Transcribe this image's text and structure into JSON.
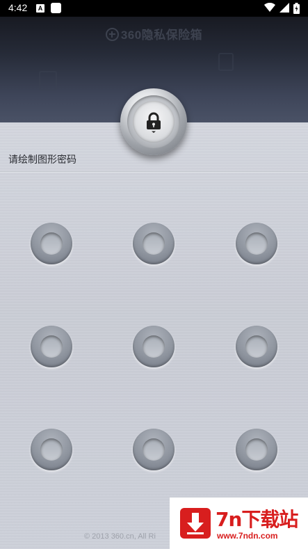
{
  "status_bar": {
    "time": "4:42",
    "a_icon_label": "A"
  },
  "header": {
    "logo_text": "360隐私保险箱"
  },
  "main": {
    "prompt": "请绘制图形密码",
    "pattern_dots_count": 9,
    "footer": "© 2013 360.cn, All Ri"
  },
  "watermark": {
    "title": "7n下载站",
    "url": "www.7ndn.com"
  },
  "icons": {
    "lock": "lock-icon",
    "wifi": "wifi-icon",
    "signal": "signal-icon",
    "battery": "battery-icon",
    "download": "download-icon"
  },
  "colors": {
    "header_dark": "#181a22",
    "main_bg": "#c9ccd5",
    "watermark_red": "#d81e1e"
  }
}
